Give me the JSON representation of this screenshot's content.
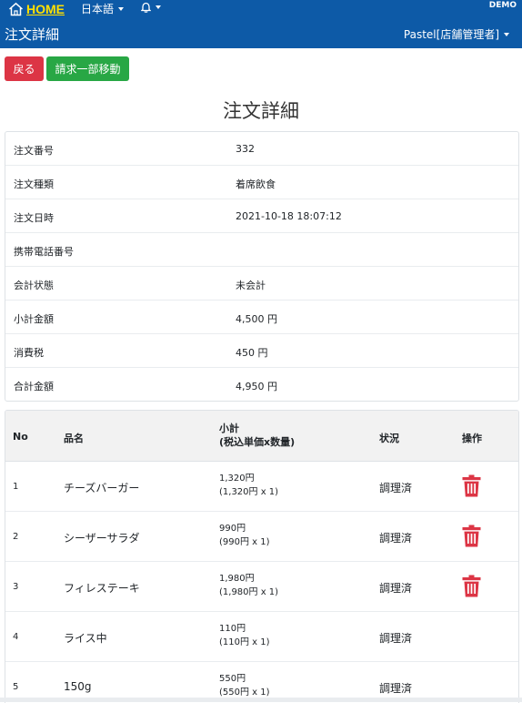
{
  "header": {
    "home_label": "HOME",
    "language_label": "日本語",
    "env_badge": "DEMO",
    "page_subtitle": "注文詳細",
    "user_label": "Pastel[店舗管理者]"
  },
  "actions": {
    "back_label": "戻る",
    "move_label": "請求一部移動"
  },
  "page_title": "注文詳細",
  "order_info": [
    {
      "label": "注文番号",
      "value": "332"
    },
    {
      "label": "注文種類",
      "value": "着席飲食"
    },
    {
      "label": "注文日時",
      "value": "2021-10-18 18:07:12"
    },
    {
      "label": "携帯電話番号",
      "value": ""
    },
    {
      "label": "会計状態",
      "value": "未会計"
    },
    {
      "label": "小計金額",
      "value": "4,500 円"
    },
    {
      "label": "消費税",
      "value": "450 円"
    },
    {
      "label": "合計金額",
      "value": "4,950 円"
    }
  ],
  "items_table": {
    "headers": {
      "no": "No",
      "name": "品名",
      "subtotal": "小計",
      "subtotal_note": "(税込単価x数量)",
      "status": "状況",
      "action": "操作"
    },
    "rows": [
      {
        "no": "1",
        "name": "チーズバーガー",
        "subtotal": "1,320円",
        "detail": "(1,320円 x 1)",
        "status": "調理済",
        "deletable": true
      },
      {
        "no": "2",
        "name": "シーザーサラダ",
        "subtotal": "990円",
        "detail": "(990円 x 1)",
        "status": "調理済",
        "deletable": true
      },
      {
        "no": "3",
        "name": "フィレステーキ",
        "subtotal": "1,980円",
        "detail": "(1,980円 x 1)",
        "status": "調理済",
        "deletable": true
      },
      {
        "no": "4",
        "name": "ライス中",
        "subtotal": "110円",
        "detail": "(110円 x 1)",
        "status": "調理済",
        "deletable": false
      },
      {
        "no": "5",
        "name": "150g",
        "subtotal": "550円",
        "detail": "(550円 x 1)",
        "status": "調理済",
        "deletable": false
      }
    ]
  },
  "icons": {
    "home": "home-icon",
    "bell": "bell-icon",
    "trash": "trash-icon"
  },
  "colors": {
    "header_bg": "#0d5aa7",
    "home_accent": "#ffe000",
    "back_button": "#dc3545",
    "move_button": "#28a745",
    "trash": "#dc3545"
  }
}
